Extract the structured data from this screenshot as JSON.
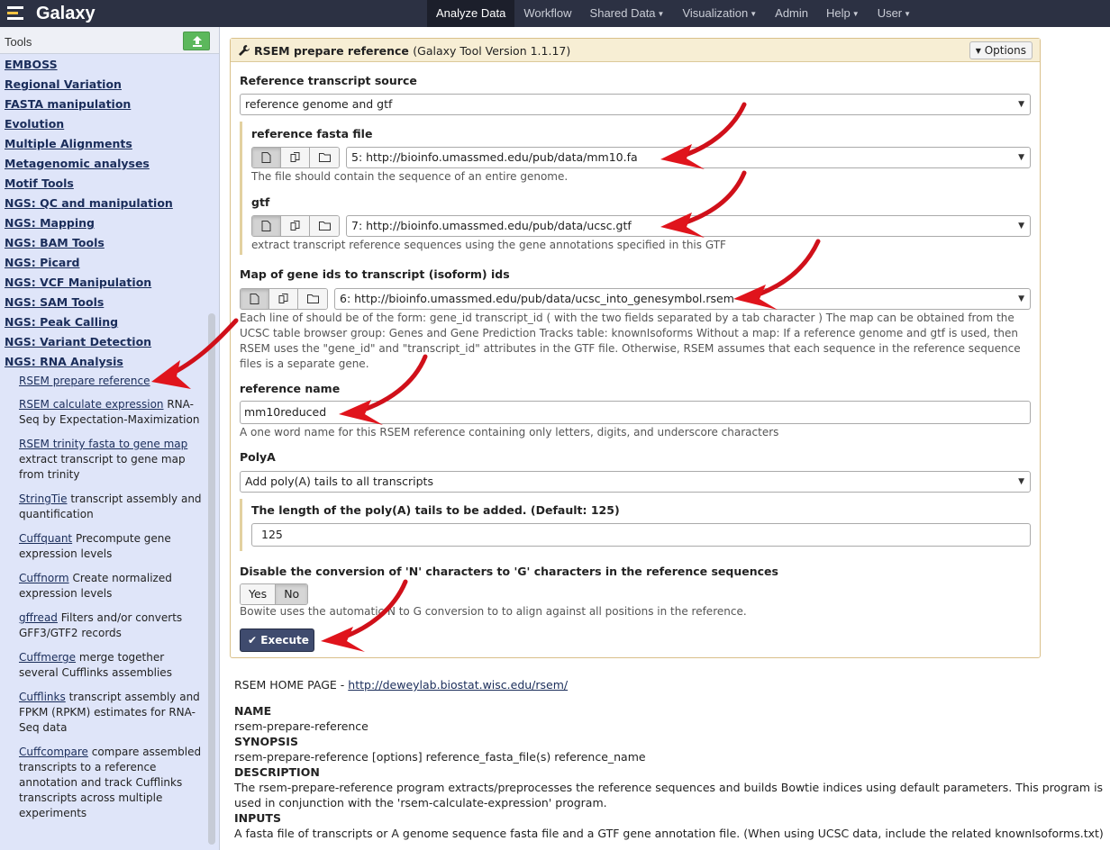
{
  "masthead": {
    "brand": "Galaxy",
    "nav": [
      {
        "label": "Analyze Data",
        "active": true,
        "dropdown": false
      },
      {
        "label": "Workflow",
        "active": false,
        "dropdown": false
      },
      {
        "label": "Shared Data",
        "active": false,
        "dropdown": true
      },
      {
        "label": "Visualization",
        "active": false,
        "dropdown": true
      },
      {
        "label": "Admin",
        "active": false,
        "dropdown": false
      },
      {
        "label": "Help",
        "active": false,
        "dropdown": true
      },
      {
        "label": "User",
        "active": false,
        "dropdown": true
      }
    ]
  },
  "left_panel": {
    "title": "Tools",
    "sections": [
      "EMBOSS",
      "Regional Variation",
      "FASTA manipulation",
      "Evolution",
      "Multiple Alignments",
      "Metagenomic analyses",
      "Motif Tools",
      "NGS: QC and manipulation",
      "NGS: Mapping",
      "NGS: BAM Tools",
      "NGS: Picard",
      "NGS: VCF Manipulation",
      "NGS: SAM Tools",
      "NGS: Peak Calling",
      "NGS: Variant Detection",
      "NGS: RNA Analysis"
    ],
    "rna_tools": [
      {
        "name": "RSEM prepare reference",
        "desc": ""
      },
      {
        "name": "RSEM calculate expression",
        "desc": "RNA-Seq by Expectation-Maximization"
      },
      {
        "name": "RSEM trinity fasta to gene map",
        "desc": "extract transcript to gene map from trinity"
      },
      {
        "name": "StringTie",
        "desc": "transcript assembly and quantification"
      },
      {
        "name": "Cuffquant",
        "desc": "Precompute gene expression levels"
      },
      {
        "name": "Cuffnorm",
        "desc": "Create normalized expression levels"
      },
      {
        "name": "gffread",
        "desc": "Filters and/or converts GFF3/GTF2 records"
      },
      {
        "name": "Cuffmerge",
        "desc": "merge together several Cufflinks assemblies"
      },
      {
        "name": "Cufflinks",
        "desc": "transcript assembly and FPKM (RPKM) estimates for RNA-Seq data"
      },
      {
        "name": "Cuffcompare",
        "desc": "compare assembled transcripts to a reference annotation and track Cufflinks transcripts across multiple experiments"
      }
    ]
  },
  "form": {
    "tool_name": "RSEM prepare reference",
    "tool_version": "(Galaxy Tool Version 1.1.17)",
    "options_label": "Options",
    "ref_source_label": "Reference transcript source",
    "ref_source_value": "reference genome and gtf",
    "fasta_label": "reference fasta file",
    "fasta_value": "5: http://bioinfo.umassmed.edu/pub/data/mm10.fa",
    "fasta_help": "The file should contain the sequence of an entire genome.",
    "gtf_label": "gtf",
    "gtf_value": "7: http://bioinfo.umassmed.edu/pub/data/ucsc.gtf",
    "gtf_help": "extract transcript reference sequences using the gene annotations specified in this GTF",
    "map_label": "Map of gene ids to transcript (isoform) ids",
    "map_value": "6: http://bioinfo.umassmed.edu/pub/data/ucsc_into_genesymbol.rsem",
    "map_help": "Each line of should be of the form: gene_id transcript_id ( with the two fields separated by a tab character ) The map can be obtained from the UCSC table browser group: Genes and Gene Prediction Tracks table: knownIsoforms Without a map: If a reference genome and gtf is used, then RSEM uses the \"gene_id\" and \"transcript_id\" attributes in the GTF file. Otherwise, RSEM assumes that each sequence in the reference sequence files is a separate gene.",
    "refname_label": "reference name",
    "refname_value": "mm10reduced",
    "refname_help": "A one word name for this RSEM reference containing only letters, digits, and underscore characters",
    "polya_label": "PolyA",
    "polya_value": "Add poly(A) tails to all transcripts",
    "polya_len_label": "The length of the poly(A) tails to be added. (Default: 125)",
    "polya_len_value": "125",
    "nconv_label": "Disable the conversion of 'N' characters to 'G' characters in the reference sequences",
    "nconv_yes": "Yes",
    "nconv_no": "No",
    "nconv_help": "Bowite uses the automatic N to G conversion to to align against all positions in the reference.",
    "execute_label": "Execute"
  },
  "help": {
    "home_prefix": "RSEM HOME PAGE - ",
    "home_link": "http://deweylab.biostat.wisc.edu/rsem/",
    "name_h": "NAME",
    "name_t": "rsem-prepare-reference",
    "syn_h": "SYNOPSIS",
    "syn_t": "rsem-prepare-reference [options] reference_fasta_file(s) reference_name",
    "desc_h": "DESCRIPTION",
    "desc_t": "The rsem-prepare-reference program extracts/preprocesses the reference sequences and builds Bowtie indices using default parameters. This program is used in conjunction with the 'rsem-calculate-expression' program.",
    "inputs_h": "INPUTS",
    "inputs_t": "A fasta file of transcripts or A genome sequence fasta file and a GTF gene annotation file. (When using UCSC data, include the related knownIsoforms.txt)"
  },
  "colors": {
    "masthead": "#2c3143",
    "tool_panel": "#dfe5f9",
    "form_header": "#f7eed4",
    "execute": "#3f4b6e",
    "arrow": "#e0141c"
  }
}
